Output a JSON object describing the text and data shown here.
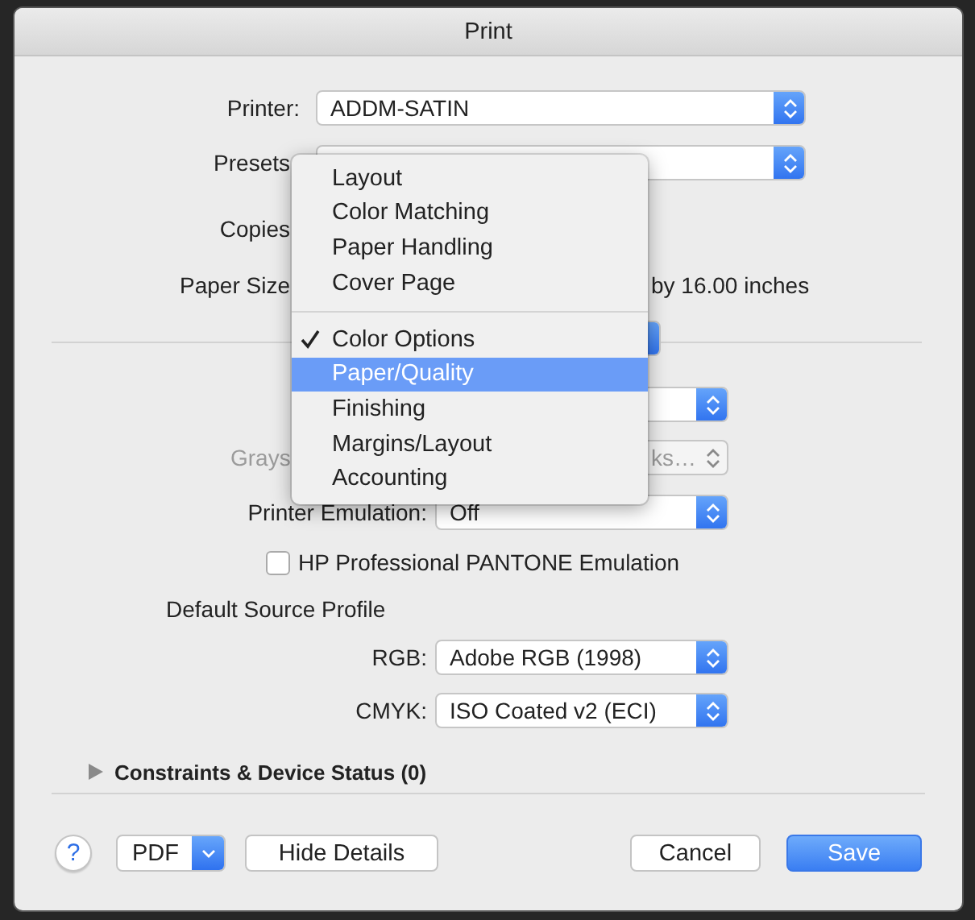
{
  "window": {
    "title": "Print"
  },
  "printer": {
    "label": "Printer:",
    "value": "ADDM-SATIN"
  },
  "presets": {
    "label": "Presets"
  },
  "copies": {
    "label": "Copies"
  },
  "paper_size": {
    "label": "Paper Size",
    "value": "by 16.00 inches"
  },
  "section_menu": {
    "groups": [
      [
        {
          "label": "Layout",
          "checked": false,
          "selected": false
        },
        {
          "label": "Color Matching",
          "checked": false,
          "selected": false
        },
        {
          "label": "Paper Handling",
          "checked": false,
          "selected": false
        },
        {
          "label": "Cover Page",
          "checked": false,
          "selected": false
        }
      ],
      [
        {
          "label": "Color Options",
          "checked": true,
          "selected": false
        },
        {
          "label": "Paper/Quality",
          "checked": false,
          "selected": true
        },
        {
          "label": "Finishing",
          "checked": false,
          "selected": false
        },
        {
          "label": "Margins/Layout",
          "checked": false,
          "selected": false
        },
        {
          "label": "Accounting",
          "checked": false,
          "selected": false
        }
      ]
    ]
  },
  "grayscale": {
    "label": "Grays",
    "value": "ks…",
    "disabled": true
  },
  "printer_emulation": {
    "label": "Printer Emulation:",
    "value": "Off"
  },
  "pantone_checkbox": {
    "label": "HP Professional PANTONE Emulation",
    "checked": false
  },
  "default_source_profile": {
    "title": "Default Source Profile",
    "rgb": {
      "label": "RGB:",
      "value": "Adobe RGB (1998)"
    },
    "cmyk": {
      "label": "CMYK:",
      "value": "ISO Coated v2 (ECI)"
    }
  },
  "disclosure": {
    "label": "Constraints & Device Status (0)",
    "expanded": false
  },
  "buttons": {
    "help": "?",
    "pdf": "PDF",
    "hide_details": "Hide Details",
    "cancel": "Cancel",
    "save": "Save"
  }
}
